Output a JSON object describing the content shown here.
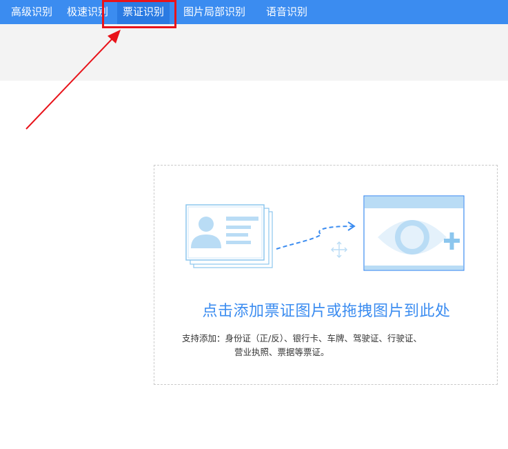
{
  "nav": {
    "tabs": [
      {
        "label": "高级识别"
      },
      {
        "label": "极速识别"
      },
      {
        "label": "票证识别",
        "active": true
      },
      {
        "label": "图片局部识别"
      },
      {
        "label": "语音识别"
      }
    ]
  },
  "upload": {
    "title": "点击添加票证图片或拖拽图片到此处",
    "support_line1": "支持添加：身份证（正/反）、银行卡、车牌、驾驶证、行驶证、",
    "support_line2": "营业执照、票据等票证。",
    "icons": [
      "id-card-icon",
      "drag-move-icon",
      "image-eye-add-icon"
    ]
  },
  "colors": {
    "nav_bg": "#3b8cf0",
    "nav_active_bg": "#2a7ae2",
    "accent": "#3b8cf0",
    "annotation_red": "#e8131a",
    "illustration_light": "#b9dcf5"
  }
}
